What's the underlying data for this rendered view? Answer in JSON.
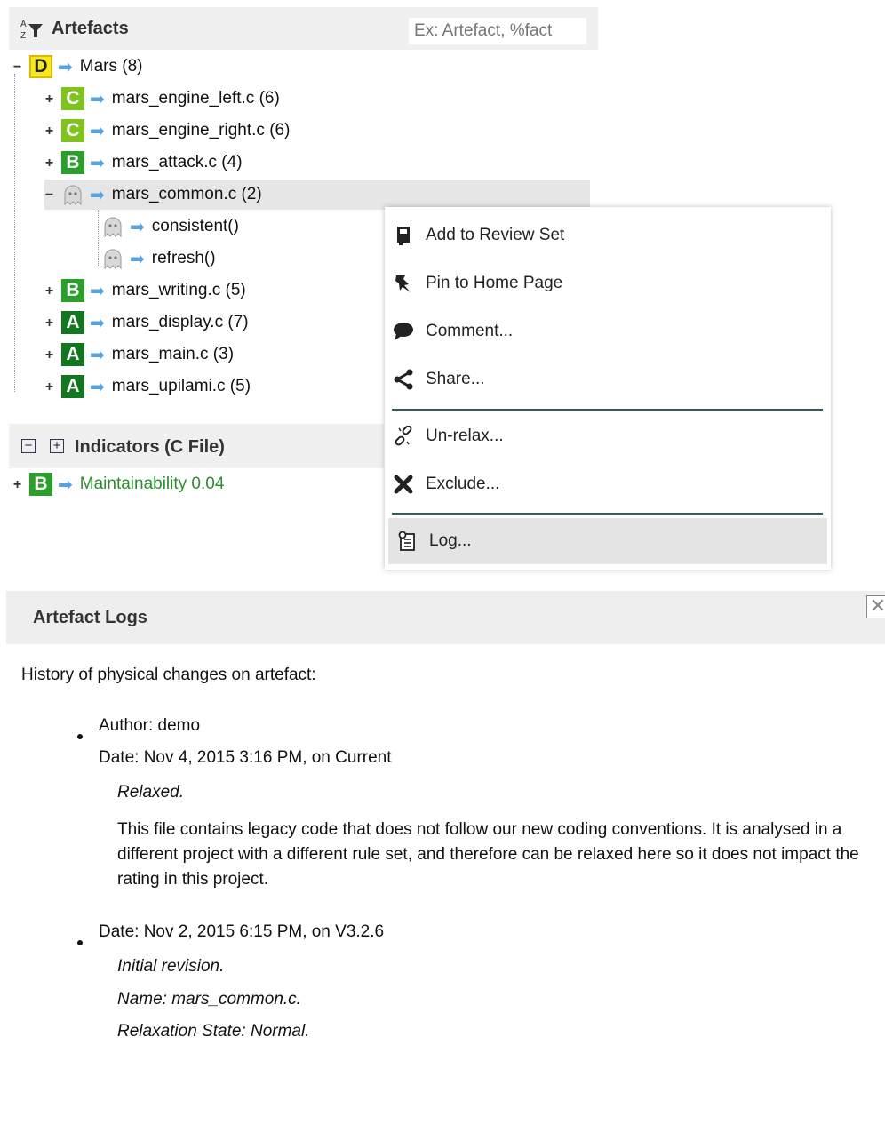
{
  "artefacts": {
    "title": "Artefacts",
    "search_placeholder": "Ex: Artefact, %fact",
    "tree": [
      {
        "label": "Mars (8)",
        "rating": "D",
        "expander": "−"
      },
      {
        "label": "mars_engine_left.c (6)",
        "rating": "C",
        "expander": "+"
      },
      {
        "label": "mars_engine_right.c (6)",
        "rating": "C",
        "expander": "+"
      },
      {
        "label": "mars_attack.c (4)",
        "rating": "B",
        "expander": "+"
      },
      {
        "label": "mars_common.c (2)",
        "rating": "ghost",
        "expander": "−"
      },
      {
        "label": "consistent()",
        "rating": "ghost",
        "expander": ""
      },
      {
        "label": "refresh()",
        "rating": "ghost",
        "expander": ""
      },
      {
        "label": "mars_writing.c (5)",
        "rating": "B",
        "expander": "+"
      },
      {
        "label": "mars_display.c (7)",
        "rating": "A",
        "expander": "+"
      },
      {
        "label": "mars_main.c (3)",
        "rating": "A",
        "expander": "+"
      },
      {
        "label": "mars_upilami.c (5)",
        "rating": "A",
        "expander": "+"
      }
    ]
  },
  "indicators": {
    "title": "Indicators (C File)",
    "items": [
      {
        "label": "Maintainability 0.04",
        "rating": "B",
        "expander": "+"
      }
    ]
  },
  "context_menu": {
    "items": [
      {
        "label": "Add to Review Set",
        "icon": "review-set-icon"
      },
      {
        "label": "Pin to Home Page",
        "icon": "pin-icon"
      },
      {
        "label": "Comment...",
        "icon": "comment-icon"
      },
      {
        "label": "Share...",
        "icon": "share-icon"
      },
      {
        "label": "Un-relax...",
        "icon": "unlink-icon"
      },
      {
        "label": "Exclude...",
        "icon": "exclude-icon"
      },
      {
        "label": "Log...",
        "icon": "log-icon"
      }
    ]
  },
  "logs": {
    "title": "Artefact Logs",
    "intro": "History of physical changes on artefact:",
    "entries": [
      {
        "author": "Author: demo",
        "date": "Date: Nov 4, 2015 3:16 PM, on Current",
        "state": "Relaxed.",
        "description": "This file contains legacy code that does not follow our new coding conventions. It is analysed in a different project with a different rule set, and therefore can be relaxed here so it does not impact the rating in this project."
      },
      {
        "date": "Date: Nov 2, 2015 6:15 PM, on V3.2.6",
        "revision": "Initial revision.",
        "name": "Name: mars_common.c.",
        "relaxation": "Relaxation State: Normal."
      }
    ]
  },
  "colors": {
    "rating_A": "#12771e",
    "rating_B": "#2a9f2a",
    "rating_C": "#7fc41c",
    "rating_D": "#f7e81d",
    "arrow": "#5aa2dc",
    "indicator_text": "#2a8f2a"
  }
}
